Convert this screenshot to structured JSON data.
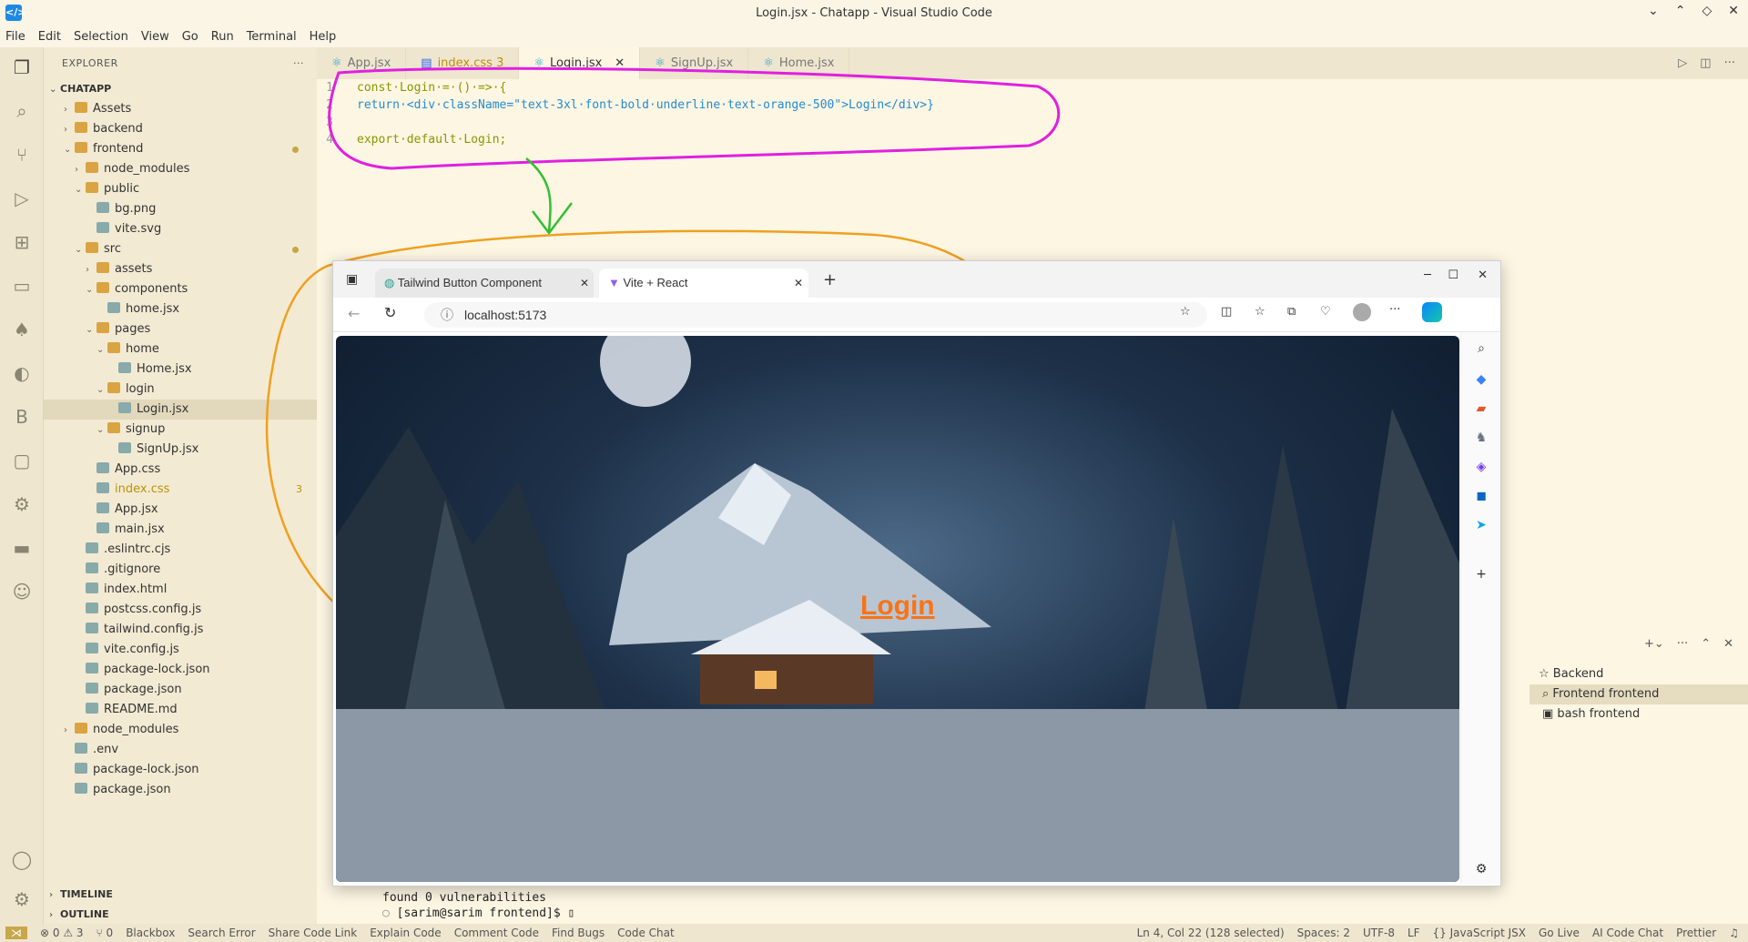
{
  "window": {
    "title": "Login.jsx - Chatapp - Visual Studio Code"
  },
  "menu": [
    "File",
    "Edit",
    "Selection",
    "View",
    "Go",
    "Run",
    "Terminal",
    "Help"
  ],
  "explorer": {
    "header": "EXPLORER",
    "root": "CHATAPP",
    "items": [
      {
        "label": "Assets",
        "depth": 1,
        "kind": "folder",
        "open": false
      },
      {
        "label": "backend",
        "depth": 1,
        "kind": "folder",
        "open": false
      },
      {
        "label": "frontend",
        "depth": 1,
        "kind": "folder",
        "open": true,
        "dot": true
      },
      {
        "label": "node_modules",
        "depth": 2,
        "kind": "folder",
        "open": false
      },
      {
        "label": "public",
        "depth": 2,
        "kind": "folder",
        "open": true
      },
      {
        "label": "bg.png",
        "depth": 3,
        "kind": "file"
      },
      {
        "label": "vite.svg",
        "depth": 3,
        "kind": "file"
      },
      {
        "label": "src",
        "depth": 2,
        "kind": "folder",
        "open": true,
        "dot": true
      },
      {
        "label": "assets",
        "depth": 3,
        "kind": "folder",
        "open": false
      },
      {
        "label": "components",
        "depth": 3,
        "kind": "folder",
        "open": true
      },
      {
        "label": "home.jsx",
        "depth": 4,
        "kind": "file"
      },
      {
        "label": "pages",
        "depth": 3,
        "kind": "folder",
        "open": true
      },
      {
        "label": "home",
        "depth": 4,
        "kind": "folder",
        "open": true
      },
      {
        "label": "Home.jsx",
        "depth": 5,
        "kind": "file"
      },
      {
        "label": "login",
        "depth": 4,
        "kind": "folder",
        "open": true
      },
      {
        "label": "Login.jsx",
        "depth": 5,
        "kind": "file",
        "selected": true
      },
      {
        "label": "signup",
        "depth": 4,
        "kind": "folder",
        "open": true
      },
      {
        "label": "SignUp.jsx",
        "depth": 5,
        "kind": "file"
      },
      {
        "label": "App.css",
        "depth": 3,
        "kind": "file"
      },
      {
        "label": "index.css",
        "depth": 3,
        "kind": "file",
        "count": "3"
      },
      {
        "label": "App.jsx",
        "depth": 3,
        "kind": "file"
      },
      {
        "label": "main.jsx",
        "depth": 3,
        "kind": "file"
      },
      {
        "label": ".eslintrc.cjs",
        "depth": 2,
        "kind": "file"
      },
      {
        "label": ".gitignore",
        "depth": 2,
        "kind": "file"
      },
      {
        "label": "index.html",
        "depth": 2,
        "kind": "file"
      },
      {
        "label": "postcss.config.js",
        "depth": 2,
        "kind": "file"
      },
      {
        "label": "tailwind.config.js",
        "depth": 2,
        "kind": "file"
      },
      {
        "label": "vite.config.js",
        "depth": 2,
        "kind": "file"
      },
      {
        "label": "package-lock.json",
        "depth": 2,
        "kind": "file"
      },
      {
        "label": "package.json",
        "depth": 2,
        "kind": "file"
      },
      {
        "label": "README.md",
        "depth": 2,
        "kind": "file"
      },
      {
        "label": "node_modules",
        "depth": 1,
        "kind": "folder",
        "open": false
      },
      {
        "label": ".env",
        "depth": 1,
        "kind": "file"
      },
      {
        "label": "package-lock.json",
        "depth": 1,
        "kind": "file"
      },
      {
        "label": "package.json",
        "depth": 1,
        "kind": "file"
      }
    ],
    "timeline": "TIMELINE",
    "outline": "OUTLINE"
  },
  "tabs": [
    {
      "label": "App.jsx"
    },
    {
      "label": "index.css 3"
    },
    {
      "label": "Login.jsx",
      "active": true
    },
    {
      "label": "SignUp.jsx"
    },
    {
      "label": "Home.jsx"
    }
  ],
  "code": {
    "line1": "const·Login·=·()·=>·{",
    "line2": "return·<div·className=\"text-3xl·font-bold·underline·text-orange-500\">Login</div>}",
    "line3": "",
    "line4": "export·default·Login;"
  },
  "browser": {
    "tab1": "Tailwind Button Component",
    "tab2": "Vite + React",
    "url": "localhost:5173",
    "page_heading": "Login"
  },
  "terminal": {
    "line1": "found 0 vulnerabilities",
    "line2": "[sarim@sarim frontend]$ ",
    "panel": [
      "Backend",
      "Frontend  frontend",
      "bash  frontend"
    ]
  },
  "status": {
    "left": [
      "⊗ 0 ⚠ 3",
      "⑂ 0",
      "Blackbox",
      "Search Error",
      "Share Code Link",
      "Explain Code",
      "Comment Code",
      "Find Bugs",
      "Code Chat"
    ],
    "right": [
      "Ln 4, Col 22 (128 selected)",
      "Spaces: 2",
      "UTF-8",
      "LF",
      "{} JavaScript JSX",
      "Go Live",
      "AI Code Chat",
      "Prettier"
    ]
  },
  "colors": {
    "accent": "#f97316",
    "annotation_magenta": "#e020e0",
    "annotation_orange": "#f0a020",
    "annotation_green": "#30c030"
  }
}
